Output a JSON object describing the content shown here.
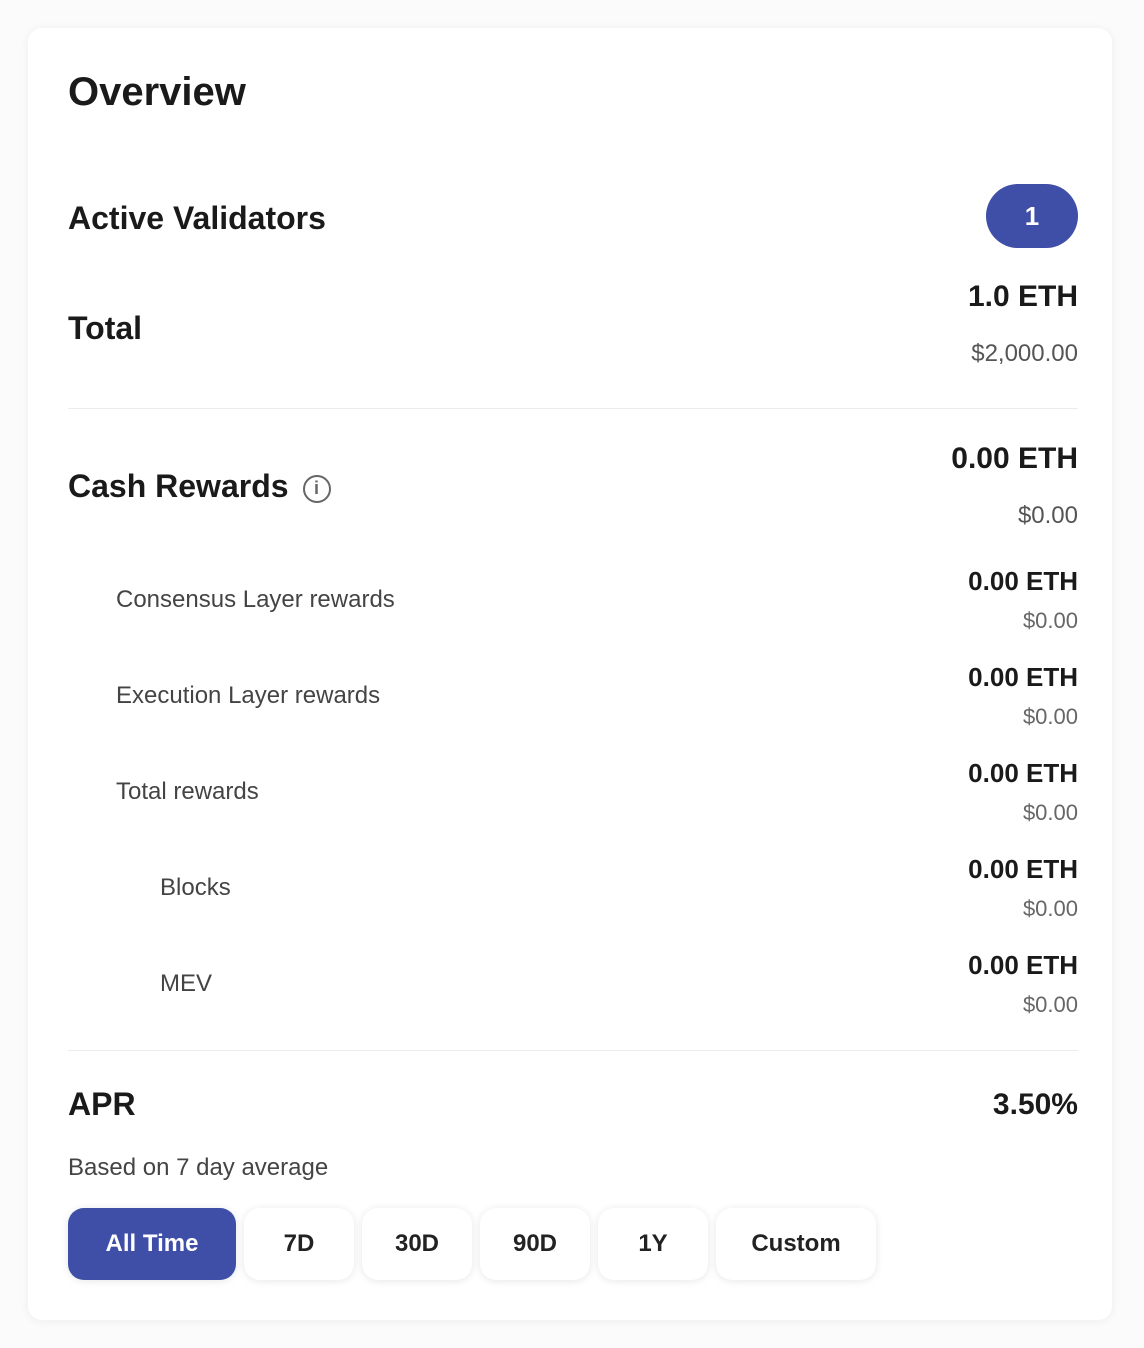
{
  "overview": {
    "title": "Overview",
    "active_validators_label": "Active Validators",
    "active_validators_count": "1",
    "total_label": "Total",
    "total_value": "1.0 ETH",
    "total_sub": "$2,000.00"
  },
  "cash_rewards": {
    "label": "Cash Rewards",
    "info_icon": "info-icon",
    "value": "0.00 ETH",
    "sub": "$0.00",
    "items": [
      {
        "label": "Consensus Layer rewards",
        "value": "0.00 ETH",
        "sub": "$0.00"
      },
      {
        "label": "Execution Layer rewards",
        "value": "0.00 ETH",
        "sub": "$0.00"
      },
      {
        "label": "Total rewards",
        "value": "0.00 ETH",
        "sub": "$0.00"
      },
      {
        "label": "Blocks",
        "value": "0.00 ETH",
        "sub": "$0.00",
        "nested": true
      },
      {
        "label": "MEV",
        "value": "0.00 ETH",
        "sub": "$0.00",
        "nested": true
      }
    ]
  },
  "apr": {
    "label": "APR",
    "value": "3.50%",
    "note": "Based on 7 day average",
    "tabs": [
      "All Time",
      "7D",
      "30D",
      "90D",
      "1Y",
      "Custom"
    ],
    "active_tab": 0
  },
  "colors": {
    "accent": "#3f4fa8"
  }
}
